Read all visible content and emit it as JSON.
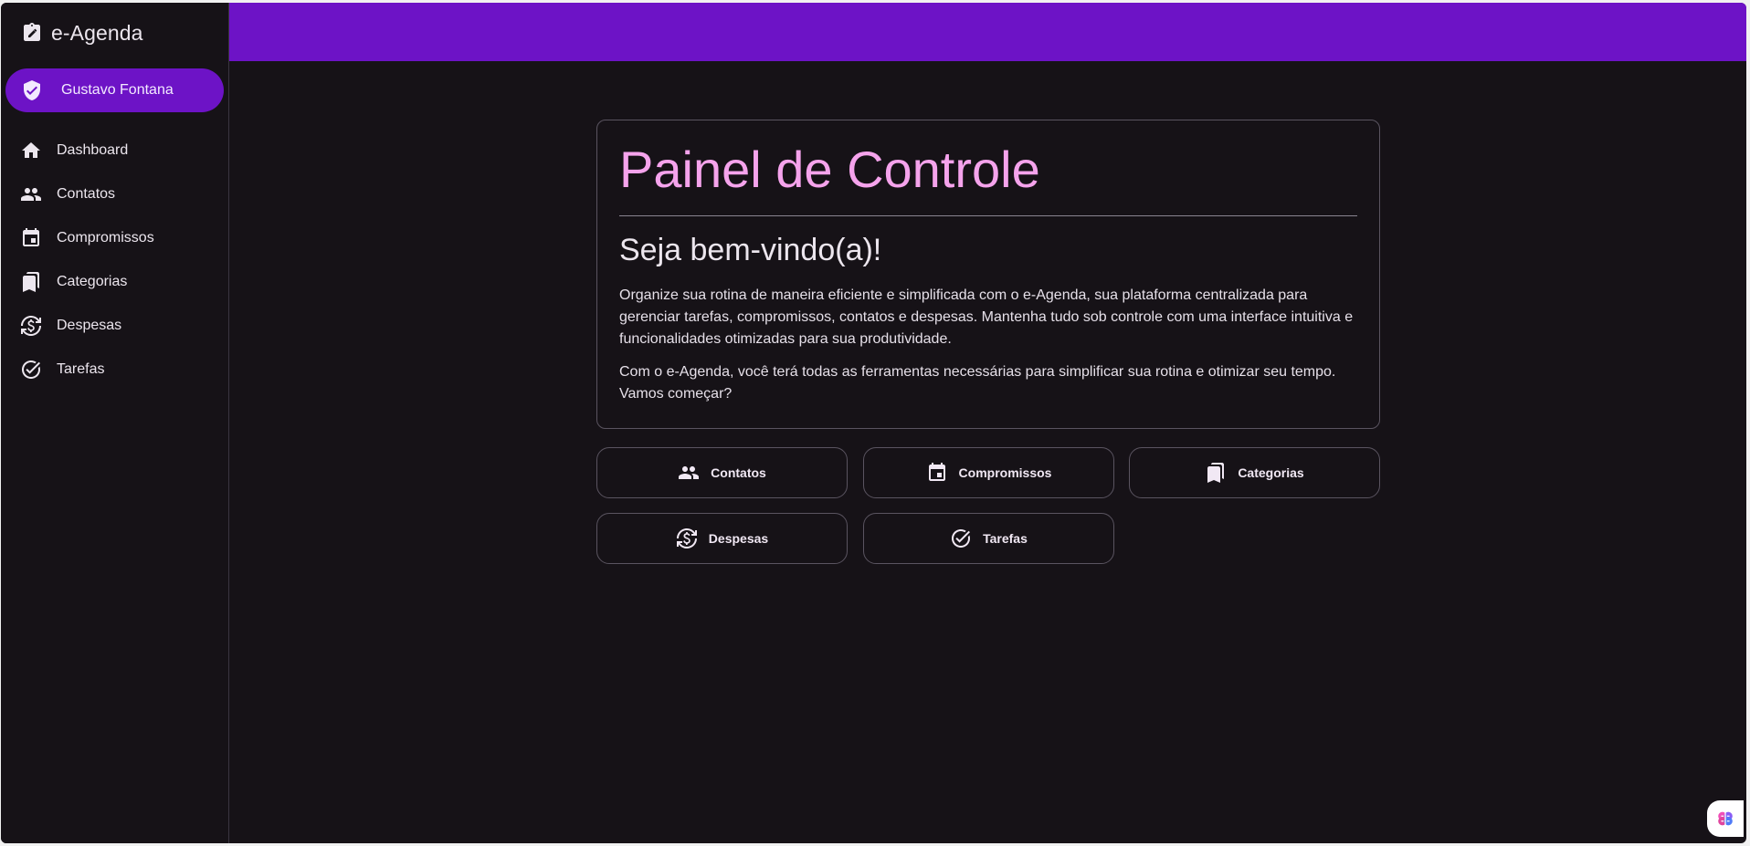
{
  "app": {
    "title": "e-Agenda",
    "user_name": "Gustavo Fontana"
  },
  "sidebar": {
    "items": [
      {
        "label": "Dashboard",
        "icon": "home-icon"
      },
      {
        "label": "Contatos",
        "icon": "people-icon"
      },
      {
        "label": "Compromissos",
        "icon": "calendar-icon"
      },
      {
        "label": "Categorias",
        "icon": "bookmarks-icon"
      },
      {
        "label": "Despesas",
        "icon": "currency-exchange-icon"
      },
      {
        "label": "Tarefas",
        "icon": "check-circle-icon"
      }
    ]
  },
  "main": {
    "title": "Painel de Controle",
    "subtitle": "Seja bem-vindo(a)!",
    "paragraph_1": "Organize sua rotina de maneira eficiente e simplificada com o e-Agenda, sua plataforma centralizada para gerenciar tarefas, compromissos, contatos e despesas. Mantenha tudo sob controle com uma interface intuitiva e funcionalidades otimizadas para sua produtividade.",
    "paragraph_2": "Com o e-Agenda, você terá todas as ferramentas necessárias para simplificar sua rotina e otimizar seu tempo. Vamos começar?",
    "quick_links": [
      {
        "label": "Contatos",
        "icon": "people-icon"
      },
      {
        "label": "Compromissos",
        "icon": "calendar-icon"
      },
      {
        "label": "Categorias",
        "icon": "bookmarks-icon"
      },
      {
        "label": "Despesas",
        "icon": "currency-exchange-icon"
      },
      {
        "label": "Tarefas",
        "icon": "check-circle-icon"
      }
    ]
  },
  "colors": {
    "accent": "#6d13c6",
    "title": "#f5a3ec",
    "background": "#161217"
  }
}
